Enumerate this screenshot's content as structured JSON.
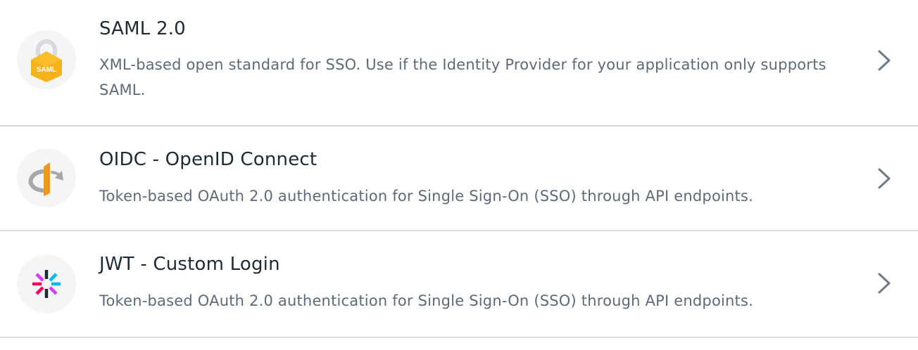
{
  "connections": [
    {
      "title": "SAML 2.0",
      "description": "XML-based open standard for SSO. Use if the Identity Provider for your application only supports SAML.",
      "icon": "saml-lock-icon",
      "icon_text": "SAML"
    },
    {
      "title": "OIDC - OpenID Connect",
      "description": "Token-based OAuth 2.0 authentication for Single Sign-On (SSO) through API endpoints.",
      "icon": "openid-icon"
    },
    {
      "title": "JWT - Custom Login",
      "description": "Token-based OAuth 2.0 authentication for Single Sign-On (SSO) through API endpoints.",
      "icon": "jwt-icon"
    }
  ],
  "colors": {
    "saml_yellow": "#f7b21b",
    "openid_orange": "#f7941d",
    "openid_gray": "#a8a8a8",
    "jwt_pink": "#fb015b",
    "jwt_purple": "#d63aff",
    "jwt_blue": "#00b9f1",
    "jwt_dark": "#1e2a35"
  }
}
